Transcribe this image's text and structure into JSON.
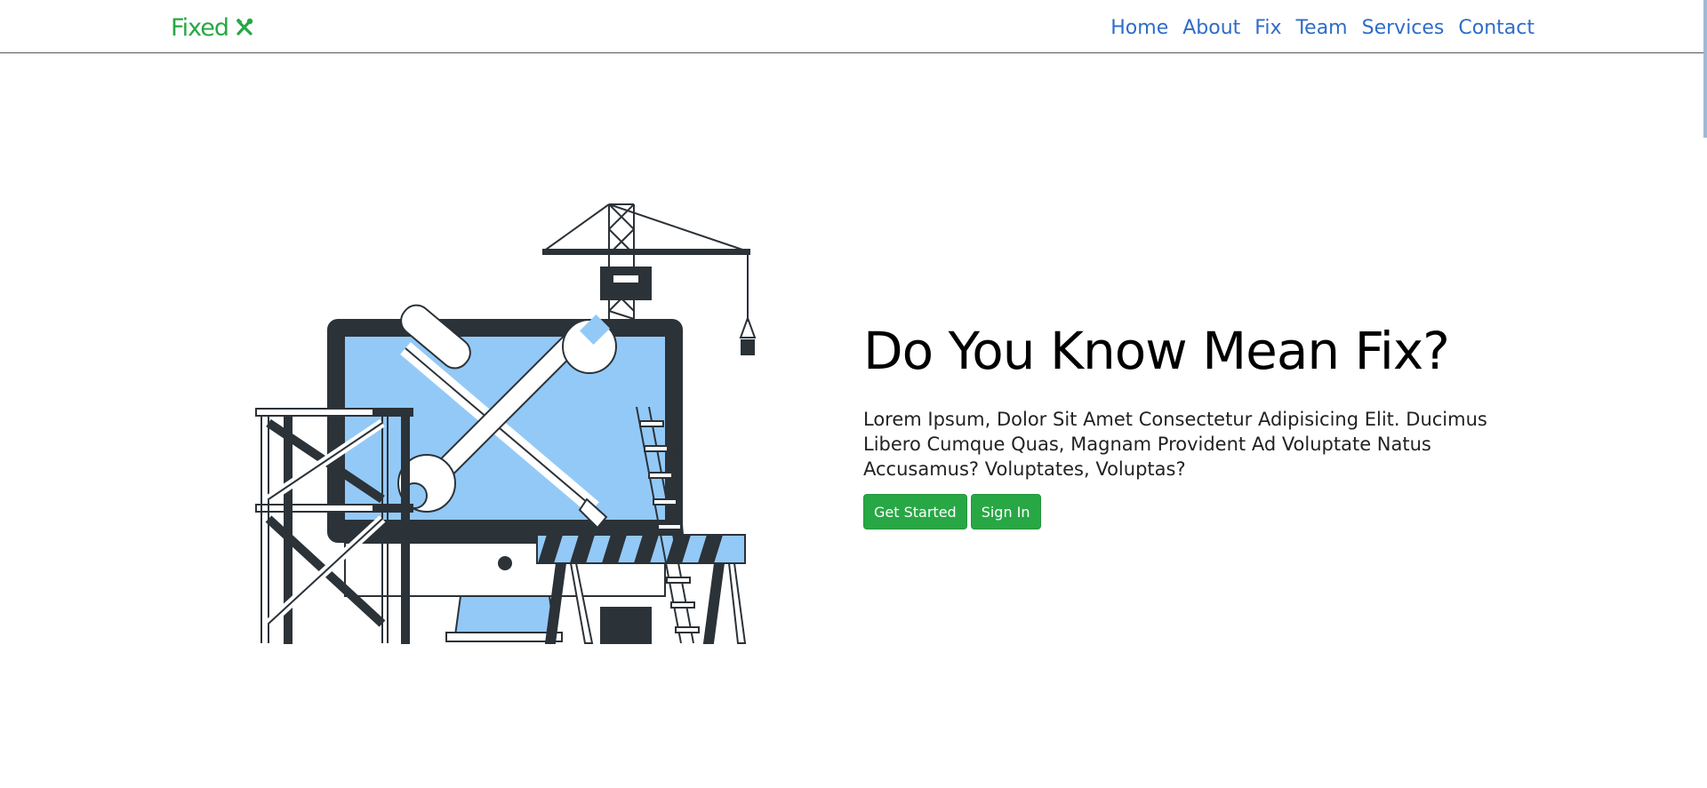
{
  "navbar": {
    "brand": "Fixed",
    "brand_icon": "tools-icon",
    "links": [
      "Home",
      "About",
      "Fix",
      "Team",
      "Services",
      "Contact"
    ]
  },
  "hero": {
    "title": "Do You Know Mean Fix?",
    "description": "Lorem Ipsum, Dolor Sit Amet Consectetur Adipisicing Elit. Ducimus Libero Cumque Quas, Magnam Provident Ad Voluptate Natus Accusamus? Voluptates, Voluptas?",
    "buttons": {
      "primary": "Get Started",
      "secondary": "Sign In"
    },
    "illustration": "computer-repair-construction-illustration"
  },
  "colors": {
    "brand_green": "#28a745",
    "nav_link": "#2e6cc9",
    "illustration_dark": "#2b3238",
    "illustration_blue": "#93c9f7"
  }
}
